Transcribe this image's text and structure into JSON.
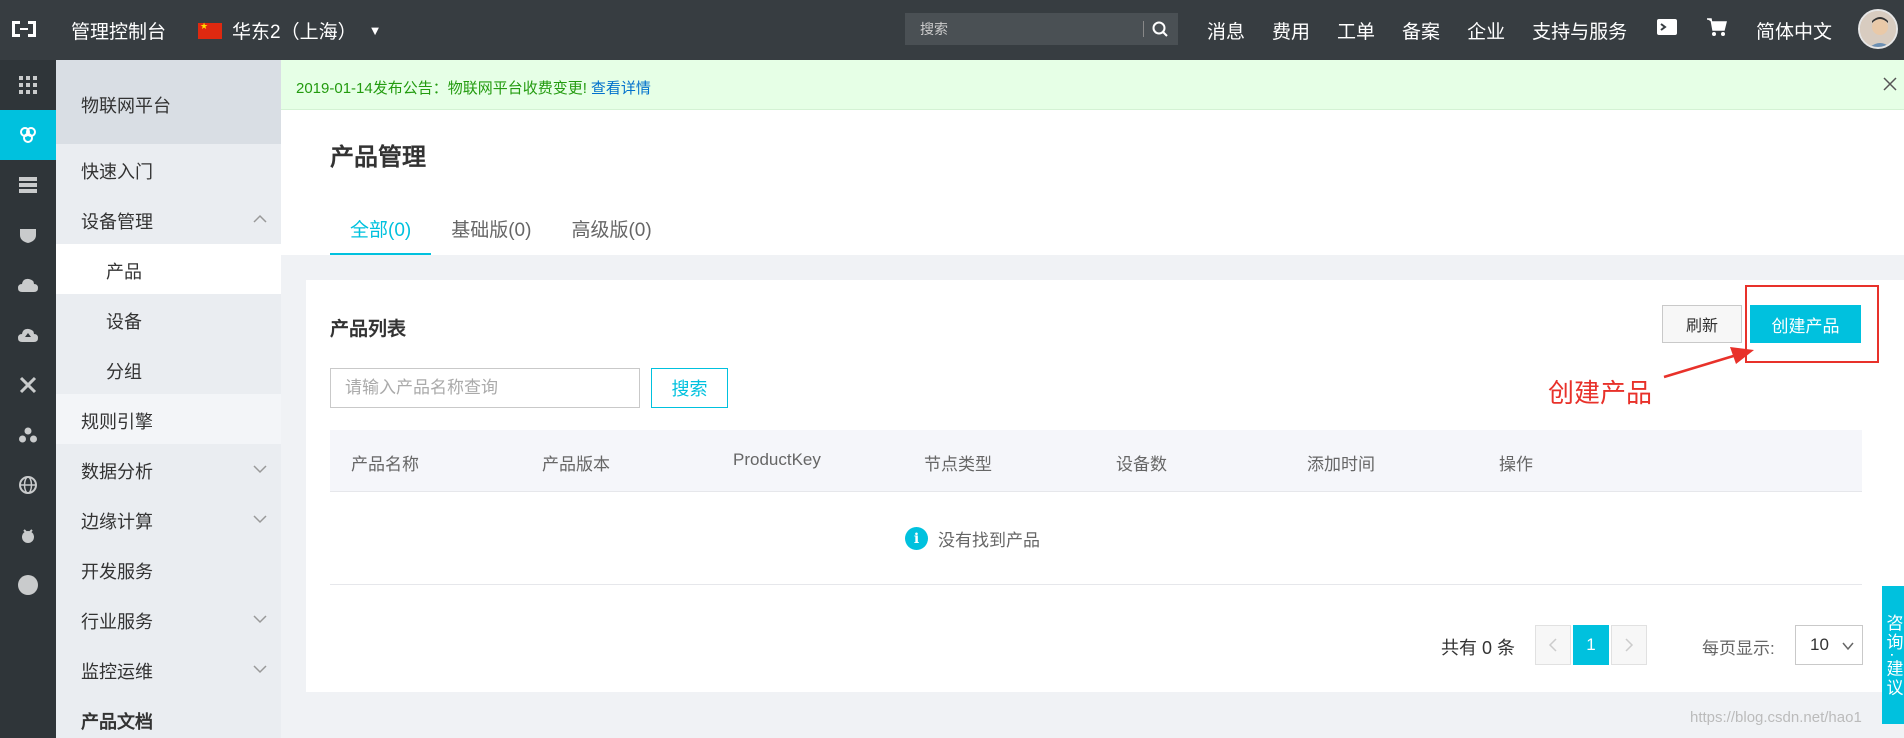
{
  "topbar": {
    "title": "管理控制台",
    "region": "华东2（上海）",
    "search_placeholder": "搜索",
    "nav": [
      "消息",
      "费用",
      "工单",
      "备案",
      "企业",
      "支持与服务"
    ],
    "language": "简体中文"
  },
  "sidebar": {
    "header": "物联网平台",
    "items": [
      {
        "label": "快速入门"
      },
      {
        "label": "设备管理"
      },
      {
        "label": "产品"
      },
      {
        "label": "设备"
      },
      {
        "label": "分组"
      },
      {
        "label": "规则引擎"
      },
      {
        "label": "数据分析"
      },
      {
        "label": "边缘计算"
      },
      {
        "label": "开发服务"
      },
      {
        "label": "行业服务"
      },
      {
        "label": "监控运维"
      },
      {
        "label": "产品文档"
      }
    ]
  },
  "notice": {
    "text": "2019-01-14发布公告：物联网平台收费变更!",
    "link": "查看详情"
  },
  "page": {
    "title": "产品管理",
    "tabs": [
      "全部(0)",
      "基础版(0)",
      "高级版(0)"
    ]
  },
  "card": {
    "title": "产品列表",
    "refresh_label": "刷新",
    "create_label": "创建产品",
    "search_placeholder": "请输入产品名称查询",
    "search_label": "搜索",
    "columns": [
      "产品名称",
      "产品版本",
      "ProductKey",
      "节点类型",
      "设备数",
      "添加时间",
      "操作"
    ],
    "empty_text": "没有找到产品"
  },
  "pagination": {
    "total": "共有 0 条",
    "current_page": "1",
    "per_page_label": "每页显示:",
    "per_page_value": "10"
  },
  "annotation": {
    "text": "创建产品"
  },
  "feedback": {
    "label": "咨询·建议"
  },
  "watermark": "https://blog.csdn.net/hao1",
  "colors": {
    "accent": "#00c1de",
    "topbar": "#373d41",
    "annotation": "#e8312a"
  }
}
